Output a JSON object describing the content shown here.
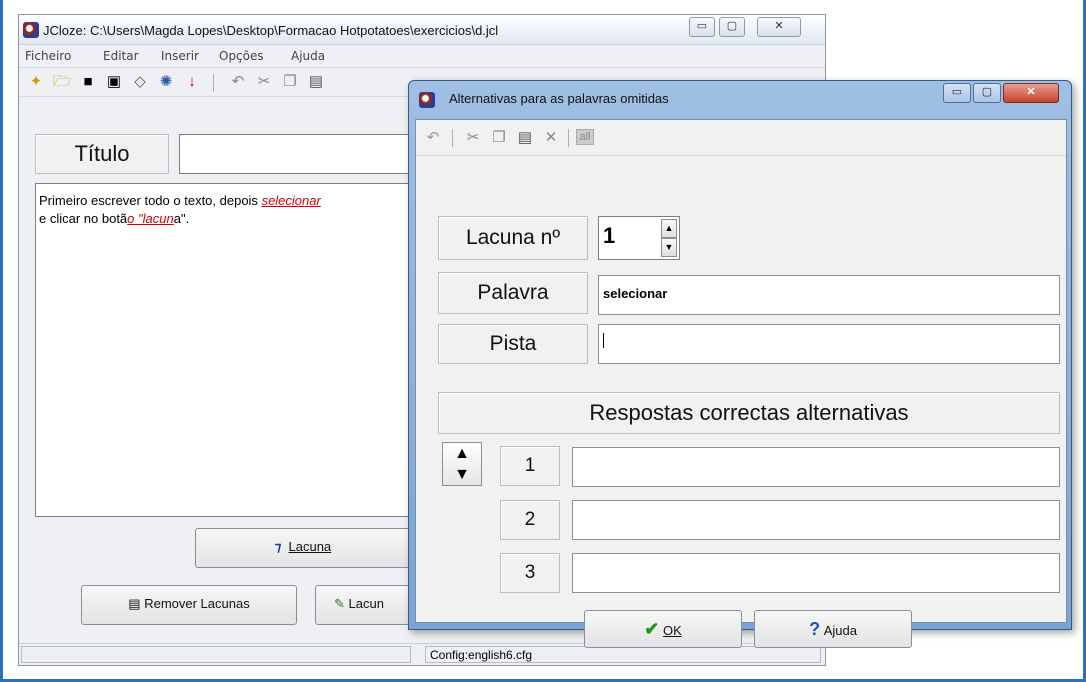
{
  "main_window": {
    "title": "JCloze: C:\\Users\\Magda Lopes\\Desktop\\Formacao Hotpotatoes\\exercicios\\d.jcl",
    "minimize_label": "▭",
    "maximize_label": "▢",
    "close_label": "✕",
    "menu": [
      "Ficheiro",
      "Editar",
      "Inserir",
      "Opções",
      "Ajuda"
    ],
    "titulo_label": "Título",
    "body_text_part1": "Primeiro escrever todo o texto, depois ",
    "body_text_link1": "selecionar",
    "body_text_part2": "e clicar no botã",
    "body_text_link2": "o \"lacun",
    "body_text_part3": "a\".",
    "lacuna_button": "Lacuna",
    "remover_button": "Remover Lacunas",
    "lacuna_auto_button": "Lacun",
    "status_config": "Config:english6.cfg"
  },
  "dialog": {
    "title": "Alternativas para as palavras omitidas",
    "lacuna_label": "Lacuna nº",
    "lacuna_value": "1",
    "palavra_label": "Palavra",
    "palavra_value": "selecionar",
    "pista_label": "Pista",
    "pista_value": "",
    "alternatives_header": "Respostas correctas alternativas",
    "alt_numbers": [
      "1",
      "2",
      "3"
    ],
    "alt_values": [
      "",
      "",
      ""
    ],
    "ok_button": "OK",
    "help_button": "Ajuda"
  },
  "colors": {
    "frame_blue": "#2f6fbe",
    "link_red": "#d40000",
    "ok_check_green": "#1d9a1d",
    "help_blue": "#1f55c8"
  }
}
